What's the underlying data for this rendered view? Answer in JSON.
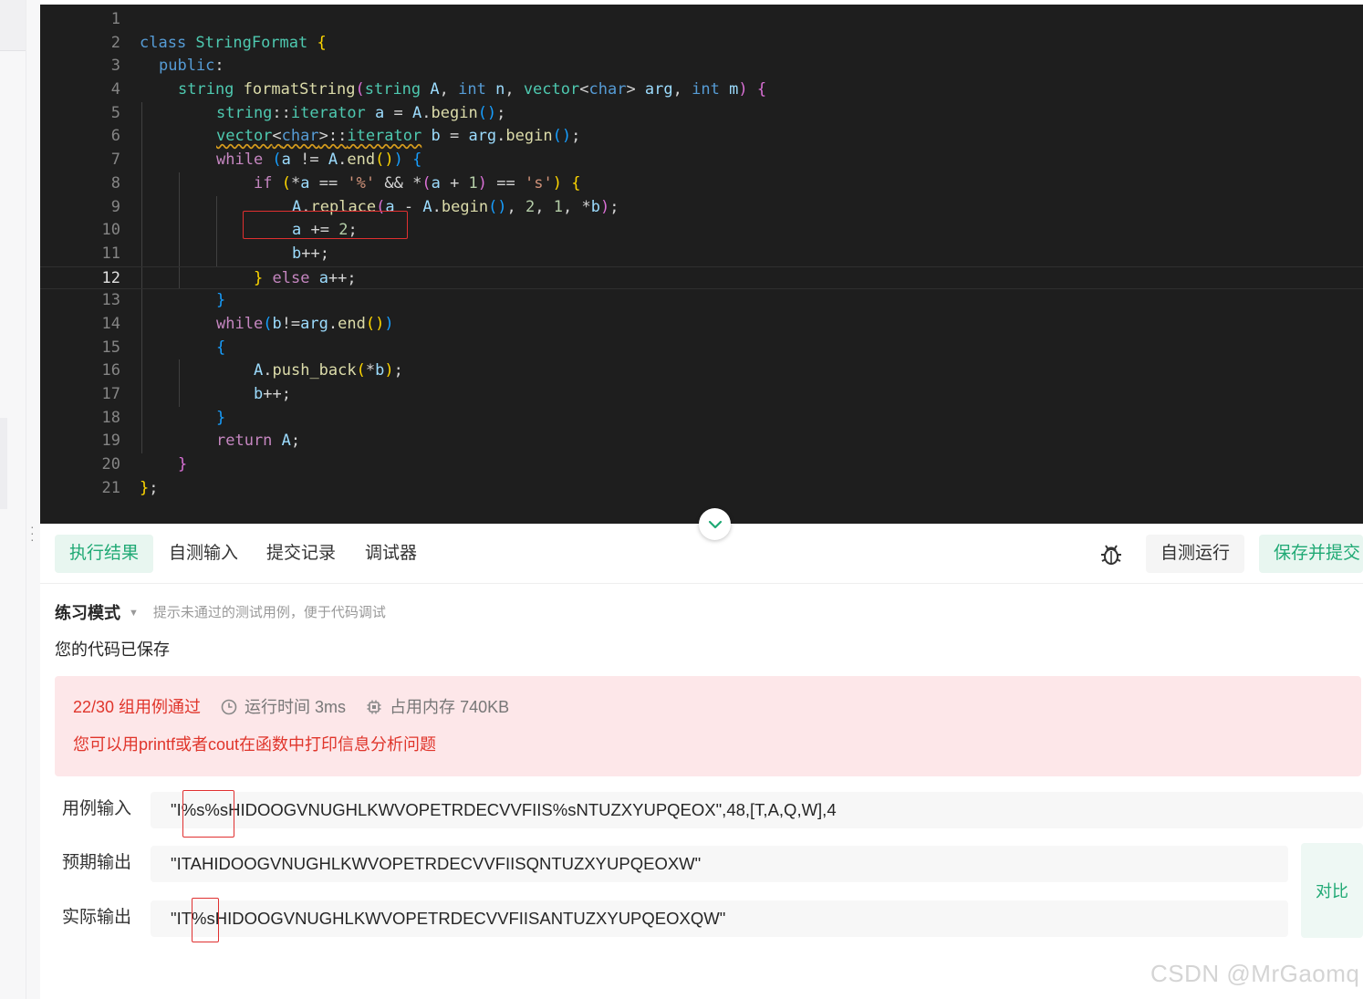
{
  "editor": {
    "line_numbers": [
      "1",
      "2",
      "3",
      "4",
      "5",
      "6",
      "7",
      "8",
      "9",
      "10",
      "11",
      "12",
      "13",
      "14",
      "15",
      "16",
      "17",
      "18",
      "19",
      "20",
      "21"
    ],
    "current_line": 12,
    "lines": [
      [],
      [
        [
          "kw",
          "class "
        ],
        [
          "ty",
          "StringFormat "
        ],
        [
          "b1",
          "{"
        ]
      ],
      [
        [
          "kw",
          "public"
        ],
        [
          "plain",
          ":"
        ]
      ],
      [
        [
          "ty",
          "string "
        ],
        [
          "fn",
          "formatString"
        ],
        [
          "b2",
          "("
        ],
        [
          "ty",
          "string "
        ],
        [
          "id",
          "A"
        ],
        [
          "plain",
          ", "
        ],
        [
          "kw",
          "int "
        ],
        [
          "id",
          "n"
        ],
        [
          "plain",
          ", "
        ],
        [
          "ty",
          "vector"
        ],
        [
          "plain",
          "<"
        ],
        [
          "kw",
          "char"
        ],
        [
          "plain",
          "> "
        ],
        [
          "id",
          "arg"
        ],
        [
          "plain",
          ", "
        ],
        [
          "kw",
          "int "
        ],
        [
          "id",
          "m"
        ],
        [
          "b2",
          ")"
        ],
        [
          "plain",
          " "
        ],
        [
          "b2",
          "{"
        ]
      ],
      [
        [
          "ty",
          "string"
        ],
        [
          "plain",
          "::"
        ],
        [
          "ty",
          "iterator "
        ],
        [
          "id",
          "a"
        ],
        [
          "plain",
          " = "
        ],
        [
          "id",
          "A"
        ],
        [
          "plain",
          "."
        ],
        [
          "fn",
          "begin"
        ],
        [
          "b3",
          "()"
        ],
        [
          "plain",
          ";"
        ]
      ],
      [
        [
          "ty squig",
          "vector"
        ],
        [
          "plain squig",
          "<"
        ],
        [
          "kw squig",
          "char"
        ],
        [
          "plain squig",
          ">::"
        ],
        [
          "ty squig",
          "iterator"
        ],
        [
          "plain",
          " "
        ],
        [
          "id",
          "b"
        ],
        [
          "plain",
          " = "
        ],
        [
          "id",
          "arg"
        ],
        [
          "plain",
          "."
        ],
        [
          "fn",
          "begin"
        ],
        [
          "b3",
          "()"
        ],
        [
          "plain",
          ";"
        ]
      ],
      [
        [
          "kw2",
          "while "
        ],
        [
          "b3",
          "("
        ],
        [
          "id",
          "a"
        ],
        [
          "plain",
          " != "
        ],
        [
          "id",
          "A"
        ],
        [
          "plain",
          "."
        ],
        [
          "fn",
          "end"
        ],
        [
          "b1",
          "()"
        ],
        [
          "b3",
          ")"
        ],
        [
          "plain",
          " "
        ],
        [
          "b3",
          "{"
        ]
      ],
      [
        [
          "kw2",
          "if "
        ],
        [
          "b1",
          "("
        ],
        [
          "plain",
          "*"
        ],
        [
          "id",
          "a"
        ],
        [
          "plain",
          " == "
        ],
        [
          "str",
          "'%'"
        ],
        [
          "plain",
          " && *"
        ],
        [
          "b2",
          "("
        ],
        [
          "id",
          "a"
        ],
        [
          "plain",
          " + "
        ],
        [
          "num",
          "1"
        ],
        [
          "b2",
          ")"
        ],
        [
          "plain",
          " == "
        ],
        [
          "str",
          "'s'"
        ],
        [
          "b1",
          ")"
        ],
        [
          "plain",
          " "
        ],
        [
          "b1",
          "{"
        ]
      ],
      [
        [
          "id",
          "A"
        ],
        [
          "plain",
          "."
        ],
        [
          "fn",
          "replace"
        ],
        [
          "b2",
          "("
        ],
        [
          "id",
          "a"
        ],
        [
          "plain",
          " - "
        ],
        [
          "id",
          "A"
        ],
        [
          "plain",
          "."
        ],
        [
          "fn",
          "begin"
        ],
        [
          "b3",
          "()"
        ],
        [
          "plain",
          ", "
        ],
        [
          "num",
          "2"
        ],
        [
          "plain",
          ", "
        ],
        [
          "num",
          "1"
        ],
        [
          "plain",
          ", *"
        ],
        [
          "id",
          "b"
        ],
        [
          "b2",
          ")"
        ],
        [
          "plain",
          ";"
        ]
      ],
      [
        [
          "id",
          "a"
        ],
        [
          "plain",
          " += "
        ],
        [
          "num",
          "2"
        ],
        [
          "plain",
          ";"
        ]
      ],
      [
        [
          "id",
          "b"
        ],
        [
          "plain",
          "++;"
        ]
      ],
      [
        [
          "b1",
          "}"
        ],
        [
          "plain",
          " "
        ],
        [
          "kw2",
          "else "
        ],
        [
          "id",
          "a"
        ],
        [
          "plain",
          "++;"
        ]
      ],
      [
        [
          "b3",
          "}"
        ]
      ],
      [
        [
          "kw2",
          "while"
        ],
        [
          "b3",
          "("
        ],
        [
          "id",
          "b"
        ],
        [
          "plain",
          "!="
        ],
        [
          "id",
          "arg"
        ],
        [
          "plain",
          "."
        ],
        [
          "fn",
          "end"
        ],
        [
          "b1",
          "()"
        ],
        [
          "b3",
          ")"
        ]
      ],
      [
        [
          "b3",
          "{"
        ]
      ],
      [
        [
          "id",
          "A"
        ],
        [
          "plain",
          "."
        ],
        [
          "fn",
          "push_back"
        ],
        [
          "b1",
          "("
        ],
        [
          "plain",
          "*"
        ],
        [
          "id",
          "b"
        ],
        [
          "b1",
          ")"
        ],
        [
          "plain",
          ";"
        ]
      ],
      [
        [
          "id",
          "b"
        ],
        [
          "plain",
          "++;"
        ]
      ],
      [
        [
          "b3",
          "}"
        ]
      ],
      [
        [
          "kw2",
          "return "
        ],
        [
          "id",
          "A"
        ],
        [
          "plain",
          ";"
        ]
      ],
      [
        [
          "b2",
          "}"
        ]
      ],
      [
        [
          "b1",
          "}"
        ],
        [
          "plain",
          ";"
        ]
      ]
    ]
  },
  "tabs": [
    {
      "label": "执行结果",
      "active": true
    },
    {
      "label": "自测输入",
      "active": false
    },
    {
      "label": "提交记录",
      "active": false
    },
    {
      "label": "调试器",
      "active": false
    }
  ],
  "toolbar": {
    "debug_icon": "bug-icon",
    "self_test_label": "自测运行",
    "submit_label": "保存并提交"
  },
  "result": {
    "mode_label": "练习模式",
    "mode_hint": "提示未通过的测试用例，便于代码调试",
    "saved_message": "您的代码已保存",
    "pass_summary": "22/30 组用例通过",
    "runtime": "运行时间 3ms",
    "memory": "占用内存 740KB",
    "tip": "您可以用printf或者cout在函数中打印信息分析问题",
    "case_input_label": "用例输入",
    "case_input_value": "\"I%s%sHIDOOGVNUGHLKWVOPETRDECVVFIIS%sNTUZXYUPQEOX\",48,[T,A,Q,W],4",
    "expected_label": "预期输出",
    "expected_value": "\"ITAHIDOOGVNUGHLKWVOPETRDECVVFIISQNTUZXYUPQEOXW\"",
    "actual_label": "实际输出",
    "actual_value": "\"IT%sHIDOOGVNUGHLKWVOPETRDECVVFIISANTUZXYUPQEOXQW\"",
    "compare_label": "对比"
  },
  "colors": {
    "accent": "#1fa974",
    "error": "#e0352b",
    "error_bg": "#fde7e9",
    "editor_bg": "#1e1e1e"
  },
  "watermark": "CSDN @MrGaomq"
}
